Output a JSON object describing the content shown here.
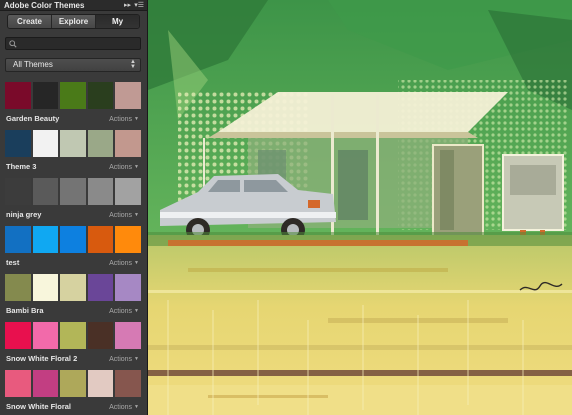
{
  "panel": {
    "title": "Adobe Color Themes",
    "collapse_glyph": "▸▸",
    "menu_glyph": "▾☰",
    "tabs": [
      {
        "label": "Create"
      },
      {
        "label": "Explore"
      },
      {
        "label": "My Themes",
        "active": true
      }
    ],
    "search": {
      "value": "",
      "placeholder": ""
    },
    "filter": {
      "label": "All Themes"
    },
    "themes": [
      {
        "name": "Garden Beauty",
        "actions": "Actions",
        "colors": [
          "#7a0a2a",
          "#262626",
          "#4a7a18",
          "#2a3e1e",
          "#c09a94"
        ]
      },
      {
        "name": "Theme 3",
        "actions": "Actions",
        "colors": [
          "#1a3e5c",
          "#f2f2f2",
          "#c0c8b2",
          "#9aa888",
          "#c2988e"
        ]
      },
      {
        "name": "ninja grey",
        "actions": "Actions",
        "colors": [
          "#3c3c3c",
          "#5a5a5a",
          "#747474",
          "#8a8a8a",
          "#a2a2a2"
        ]
      },
      {
        "name": "test",
        "actions": "Actions",
        "colors": [
          "#1270c2",
          "#10a8f2",
          "#0d80e0",
          "#d85a0e",
          "#ff8a0c"
        ]
      },
      {
        "name": "Bambi Bra",
        "actions": "Actions",
        "colors": [
          "#848a4e",
          "#f8f6dc",
          "#d6d2a0",
          "#6a4698",
          "#a688c4"
        ]
      },
      {
        "name": "Snow White Floral 2",
        "actions": "Actions",
        "colors": [
          "#e8104e",
          "#f26aaa",
          "#b2b658",
          "#4a3026",
          "#d67ab4"
        ]
      },
      {
        "name": "Snow White Floral",
        "actions": "Actions",
        "colors": [
          "#e85a7e",
          "#c23e82",
          "#aea85a",
          "#e2cac2",
          "#86564e"
        ]
      }
    ]
  },
  "artwork": {
    "palette": {
      "green": "#5eae58",
      "dark_green": "#2e7a3a",
      "yellow": "#e6d672",
      "gold": "#ead47a",
      "car": "#c8ccd0",
      "orange": "#d4682a",
      "dark": "#2e2a26"
    }
  }
}
